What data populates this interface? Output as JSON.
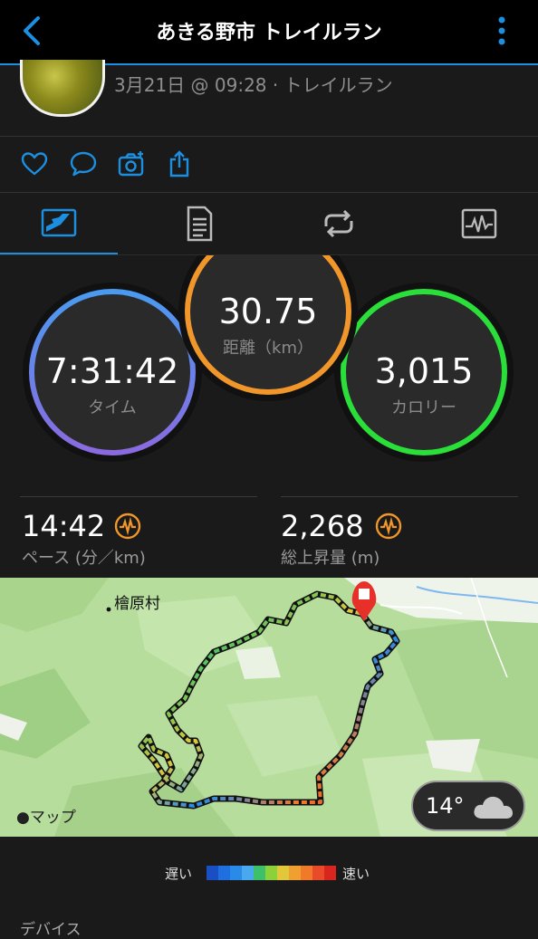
{
  "header": {
    "title": "あきる野市 トレイルラン"
  },
  "activity": {
    "meta": "3月21日 @ 09:28 · トレイルラン"
  },
  "stats": {
    "time": {
      "value": "7:31:42",
      "label": "タイム"
    },
    "distance": {
      "value": "30.75",
      "label": "距離（km）"
    },
    "calories": {
      "value": "3,015",
      "label": "カロリー"
    }
  },
  "metrics": {
    "pace": {
      "value": "14:42",
      "label": "ペース (分／km)"
    },
    "elevation": {
      "value": "2,268",
      "label": "総上昇量 (m)"
    }
  },
  "map": {
    "place_label": "檜原村",
    "attribution": "マップ",
    "weather_temp": "14°"
  },
  "legend": {
    "slow": "遅い",
    "fast": "速い",
    "colors": [
      "#1a4fc4",
      "#1f6fe0",
      "#2a8ae8",
      "#4aa8ee",
      "#3cc06a",
      "#8cd03a",
      "#e0c83a",
      "#f0a030",
      "#f07a2a",
      "#e84a2a",
      "#d8261e"
    ]
  },
  "device_label": "デバイス",
  "colors": {
    "accent": "#1d8fe0",
    "time_ring": "#5a8ef0",
    "distance_ring": "#f0962a",
    "calorie_ring": "#2adf3a"
  }
}
